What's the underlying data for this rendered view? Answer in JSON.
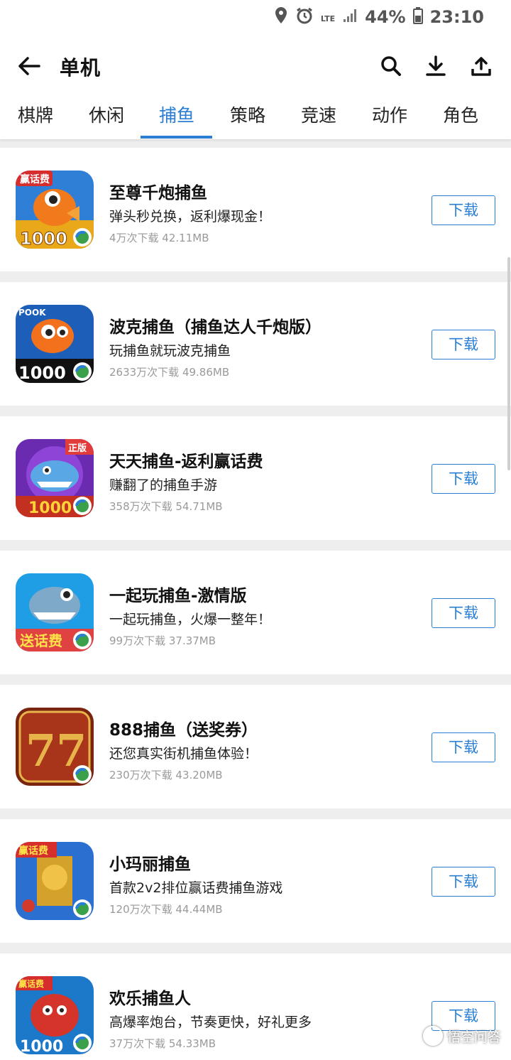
{
  "status_bar": {
    "lte": "LTE",
    "battery": "44%",
    "time": "23:10"
  },
  "header": {
    "title": "单机",
    "icons": {
      "back": "arrow-left",
      "search": "search",
      "download": "download",
      "upload": "upload"
    }
  },
  "tabs": [
    {
      "label": "棋牌",
      "active": false
    },
    {
      "label": "休闲",
      "active": false
    },
    {
      "label": "捕鱼",
      "active": true
    },
    {
      "label": "策略",
      "active": false
    },
    {
      "label": "竞速",
      "active": false
    },
    {
      "label": "动作",
      "active": false
    },
    {
      "label": "角色",
      "active": false
    }
  ],
  "apps": [
    {
      "name": "至尊千炮捕鱼",
      "desc": "弹头秒兑换，返利爆现金！",
      "meta": "4万次下载 42.11MB",
      "download_label": "下载",
      "icon_badge": "赢话费",
      "icon_number": "1000"
    },
    {
      "name": "波克捕鱼（捕鱼达人千炮版）",
      "desc": "玩捕鱼就玩波克捕鱼",
      "meta": "2633万次下载 49.86MB",
      "download_label": "下载",
      "icon_badge": "POOK",
      "icon_number": "1000"
    },
    {
      "name": "天天捕鱼-返利赢话费",
      "desc": "赚翻了的捕鱼手游",
      "meta": "358万次下载 54.71MB",
      "download_label": "下载",
      "icon_badge": "正版",
      "icon_number": "1000"
    },
    {
      "name": "一起玩捕鱼-激情版",
      "desc": "一起玩捕鱼，火爆一整年！",
      "meta": "99万次下载 37.37MB",
      "download_label": "下载",
      "icon_badge": "送话费",
      "icon_number": ""
    },
    {
      "name": "888捕鱼（送奖券）",
      "desc": "还您真实街机捕鱼体验！",
      "meta": "230万次下载 43.20MB",
      "download_label": "下载",
      "icon_badge": "",
      "icon_number": "77"
    },
    {
      "name": "小玛丽捕鱼",
      "desc": "首款2v2排位赢话费捕鱼游戏",
      "meta": "120万次下载 44.44MB",
      "download_label": "下载",
      "icon_badge": "赢话费",
      "icon_number": ""
    },
    {
      "name": "欢乐捕鱼人",
      "desc": "高爆率炮台，节奏更快，好礼更多",
      "meta": "37万次下载 54.33MB",
      "download_label": "下载",
      "icon_badge": "赢话费",
      "icon_number": "1000"
    }
  ],
  "watermark": "悟空问答",
  "colors": {
    "accent": "#2a7fd4",
    "meta_text": "#9a9a9a",
    "background": "#eeeeee"
  }
}
